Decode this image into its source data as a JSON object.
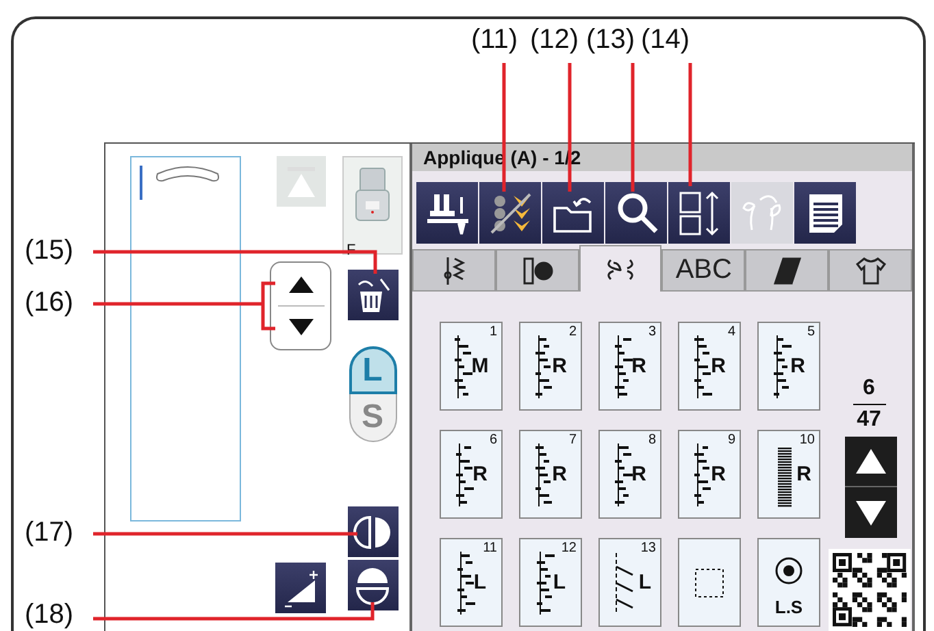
{
  "screen": {
    "title": "Applique (A) - 1/2",
    "toolbar": [
      {
        "kind": "presser-foot",
        "disabled": false
      },
      {
        "kind": "mirror",
        "disabled": false
      },
      {
        "kind": "folder-return",
        "disabled": false
      },
      {
        "kind": "search",
        "disabled": false
      },
      {
        "kind": "size",
        "disabled": false
      },
      {
        "kind": "leaves",
        "disabled": true
      },
      {
        "kind": "pages",
        "disabled": false
      }
    ],
    "tabs": [
      {
        "kind": "utility",
        "selected": false
      },
      {
        "kind": "buttonhole",
        "selected": false
      },
      {
        "kind": "decorative",
        "selected": true
      },
      {
        "kind": "text",
        "label": "ABC",
        "selected": false
      },
      {
        "kind": "quilt",
        "selected": false
      },
      {
        "kind": "garment",
        "selected": false
      }
    ],
    "patterns": [
      {
        "kind": "stitch",
        "number": "1",
        "letter": "M"
      },
      {
        "kind": "stitch",
        "number": "2",
        "letter": "R"
      },
      {
        "kind": "stitch",
        "number": "3",
        "letter": "R"
      },
      {
        "kind": "stitch",
        "number": "4",
        "letter": "R"
      },
      {
        "kind": "stitch",
        "number": "5",
        "letter": "R"
      },
      {
        "kind": "stitch",
        "number": "6",
        "letter": "R"
      },
      {
        "kind": "stitch",
        "number": "7",
        "letter": "R"
      },
      {
        "kind": "stitch",
        "number": "8",
        "letter": "R"
      },
      {
        "kind": "stitch",
        "number": "9",
        "letter": "R"
      },
      {
        "kind": "satin",
        "number": "10",
        "letter": "R"
      },
      {
        "kind": "stitch",
        "number": "11",
        "letter": "L"
      },
      {
        "kind": "stitch",
        "number": "12",
        "letter": "L"
      },
      {
        "kind": "slant",
        "number": "13",
        "letter": "L"
      },
      {
        "kind": "blank"
      },
      {
        "kind": "lock",
        "letter": "L.S"
      }
    ],
    "page": {
      "current": "6",
      "total": "47"
    },
    "foot": {
      "label": "F"
    },
    "up_button": {
      "disabled": true
    },
    "length_toggle": [
      {
        "label": "L",
        "selected": true
      },
      {
        "label": "S",
        "selected": false
      }
    ]
  },
  "callouts": [
    {
      "label": "(11)"
    },
    {
      "label": "(12)"
    },
    {
      "label": "(13)"
    },
    {
      "label": "(14)"
    },
    {
      "label": "(15)"
    },
    {
      "label": "(16)"
    },
    {
      "label": "(17)"
    },
    {
      "label": "(18)"
    }
  ]
}
